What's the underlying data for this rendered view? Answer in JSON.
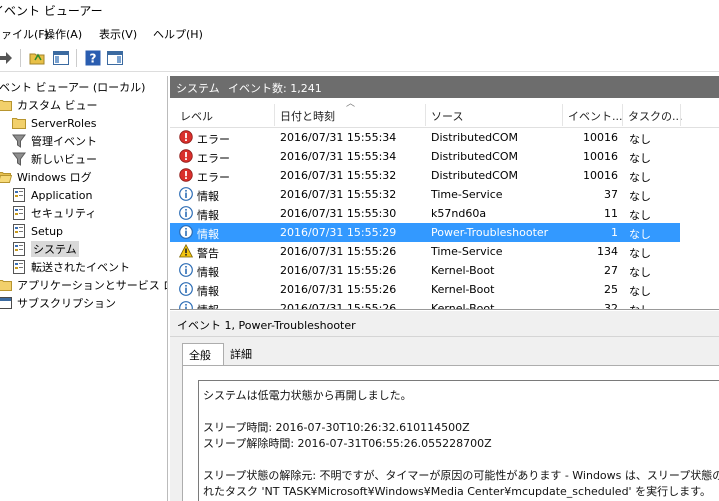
{
  "window": {
    "title": "イベント ビューアー"
  },
  "menu": [
    "ファイル(F)",
    "操作(A)",
    "表示(V)",
    "ヘルプ(H)"
  ],
  "tree": {
    "root": "イベント ビューアー (ローカル)",
    "custom_views": "カスタム ビュー",
    "server_roles": "ServerRoles",
    "admin_events": "管理イベント",
    "new_view": "新しいビュー",
    "windows_logs": "Windows ログ",
    "application": "Application",
    "security": "セキュリティ",
    "setup": "Setup",
    "system": "システム",
    "forwarded": "転送されたイベント",
    "app_service_logs": "アプリケーションとサービス ログ",
    "subscriptions": "サブスクリプション"
  },
  "panel": {
    "name": "システム",
    "count_text": "イベント数: 1,241"
  },
  "columns": {
    "level": "レベル",
    "datetime": "日付と時刻",
    "source": "ソース",
    "event_id": "イベント...",
    "task": "タスクの..."
  },
  "rows": [
    {
      "icon": "error",
      "level": "エラー",
      "datetime": "2016/07/31 15:55:34",
      "source": "DistributedCOM",
      "event_id": "10016",
      "task": "なし"
    },
    {
      "icon": "error",
      "level": "エラー",
      "datetime": "2016/07/31 15:55:34",
      "source": "DistributedCOM",
      "event_id": "10016",
      "task": "なし"
    },
    {
      "icon": "error",
      "level": "エラー",
      "datetime": "2016/07/31 15:55:32",
      "source": "DistributedCOM",
      "event_id": "10016",
      "task": "なし"
    },
    {
      "icon": "info",
      "level": "情報",
      "datetime": "2016/07/31 15:55:32",
      "source": "Time-Service",
      "event_id": "37",
      "task": "なし"
    },
    {
      "icon": "info",
      "level": "情報",
      "datetime": "2016/07/31 15:55:30",
      "source": "k57nd60a",
      "event_id": "11",
      "task": "なし"
    },
    {
      "icon": "info",
      "level": "情報",
      "datetime": "2016/07/31 15:55:29",
      "source": "Power-Troubleshooter",
      "event_id": "1",
      "task": "なし",
      "selected": true
    },
    {
      "icon": "warning",
      "level": "警告",
      "datetime": "2016/07/31 15:55:26",
      "source": "Time-Service",
      "event_id": "134",
      "task": "なし"
    },
    {
      "icon": "info",
      "level": "情報",
      "datetime": "2016/07/31 15:55:26",
      "source": "Kernel-Boot",
      "event_id": "27",
      "task": "なし"
    },
    {
      "icon": "info",
      "level": "情報",
      "datetime": "2016/07/31 15:55:26",
      "source": "Kernel-Boot",
      "event_id": "25",
      "task": "なし"
    },
    {
      "icon": "info",
      "level": "情報",
      "datetime": "2016/07/31 15:55:26",
      "source": "Kernel-Boot",
      "event_id": "32",
      "task": "なし"
    }
  ],
  "detail": {
    "title": "イベント 1, Power-Troubleshooter",
    "tabs": [
      "全般",
      "詳細"
    ],
    "lines": [
      "システムは低電力状態から再開しました。",
      "スリープ時間: 2016-07-30T10:26:32.610114500Z",
      "スリープ解除時間: 2016-07-31T06:55:26.055228700Z",
      "スリープ状態の解除元: 不明ですが、タイマーが原因の可能性があります - Windows は、スリープ状態の解除を",
      "れたタスク 'NT TASK¥Microsoft¥Windows¥Media Center¥mcupdate_scheduled' を実行します。"
    ]
  },
  "colors": {
    "selection": "#3399ff",
    "header": "#6d6d6d",
    "error": "#d9302c",
    "info": "#2d6db5",
    "warning": "#f2c511"
  }
}
